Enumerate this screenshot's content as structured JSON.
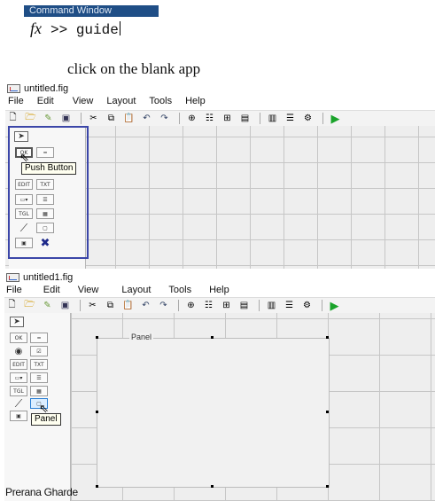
{
  "command_window": {
    "title": "Command Window",
    "prompt_symbol": "fx",
    "prompt": ">>",
    "command": "guide"
  },
  "instruction": "click on the blank app",
  "window1": {
    "title": "untitled.fig",
    "menu": [
      "File",
      "Edit",
      "View",
      "Layout",
      "Tools",
      "Help"
    ],
    "palette": [
      "arrow-icon",
      "push-button-icon",
      "slider-icon",
      "edit-text-icon",
      "static-text-icon",
      "popup-menu-icon",
      "listbox-icon",
      "toggle-button-icon",
      "table-icon",
      "axes-icon",
      "panel-icon",
      "button-group-icon",
      "activex-icon"
    ],
    "tooltip": "Push Button"
  },
  "window2": {
    "title": "untitled1.fig",
    "menu": [
      "File",
      "Edit",
      "View",
      "Layout",
      "Tools",
      "Help"
    ],
    "tooltip": "Panel",
    "panel_label": "Panel"
  },
  "credit": "Prerana Gharde",
  "colors": {
    "cmd_title_bg": "#1f4e86",
    "highlight_box": "#3b46a8",
    "run_arrow": "#1aa32a"
  }
}
